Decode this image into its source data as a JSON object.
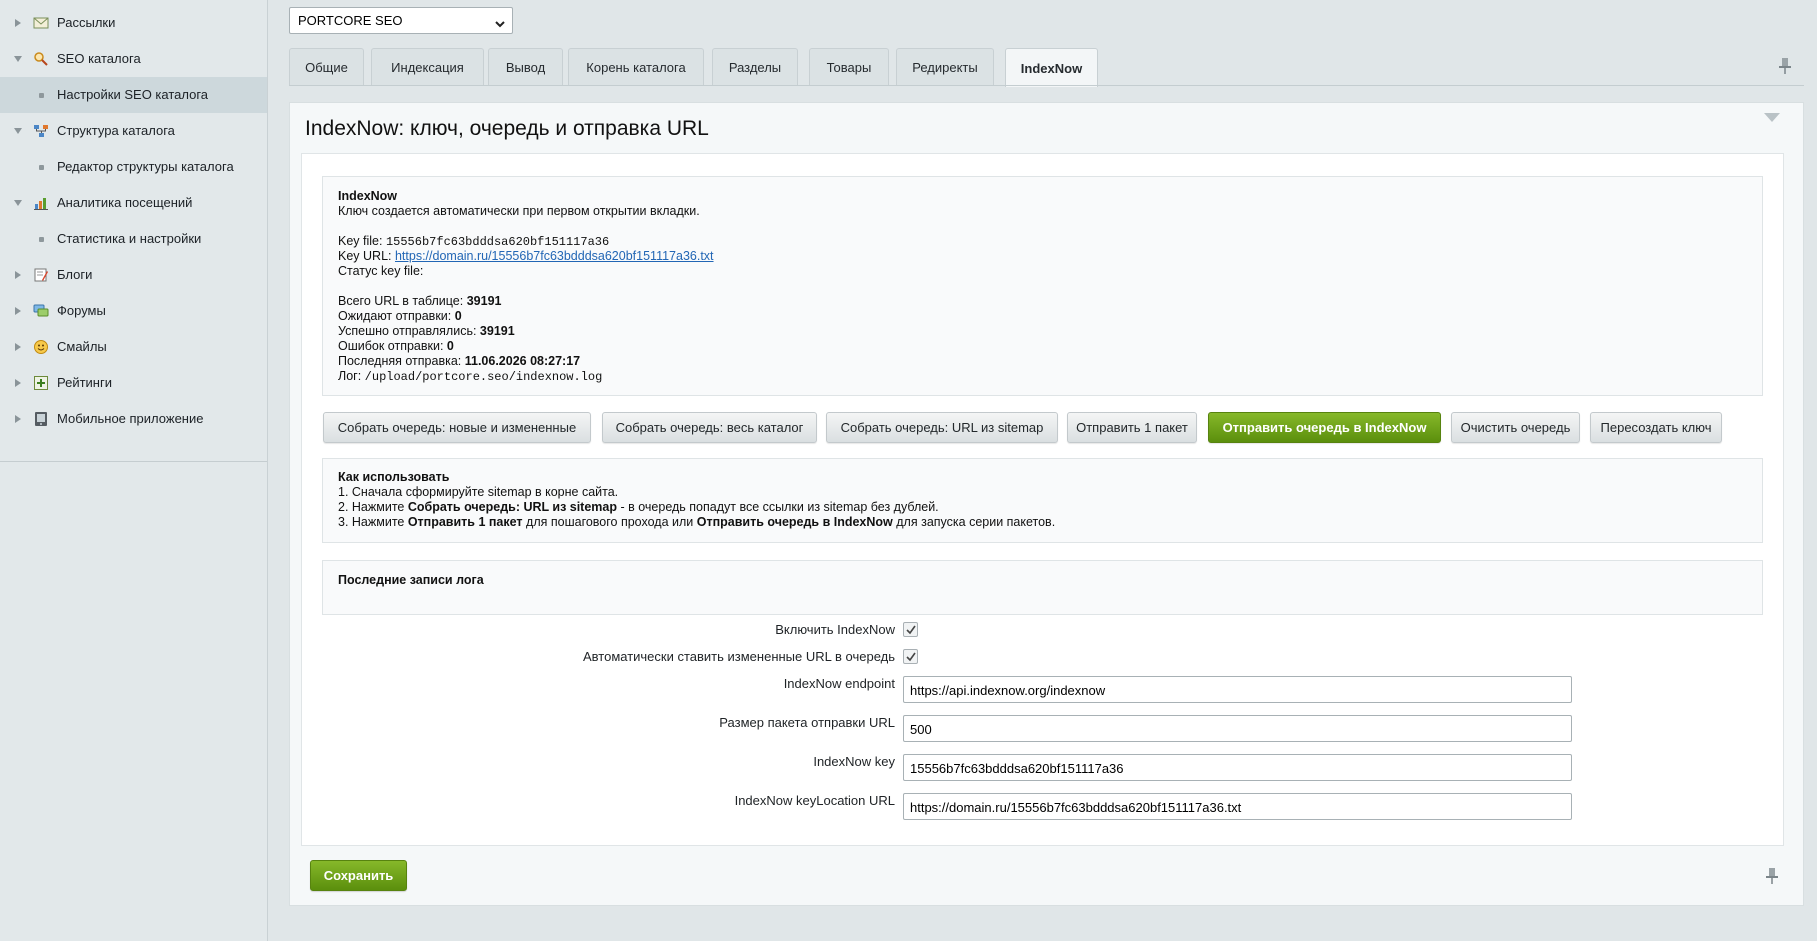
{
  "sidebar": {
    "items": [
      {
        "label": "Рассылки",
        "icon": "mail-icon"
      },
      {
        "label": "SEO каталога",
        "icon": "seo-search-icon"
      },
      {
        "label": "Настройки SEO каталога"
      },
      {
        "label": "Структура каталога",
        "icon": "structure-icon"
      },
      {
        "label": "Редактор структуры каталога"
      },
      {
        "label": "Аналитика посещений",
        "icon": "analytics-icon"
      },
      {
        "label": "Статистика и настройки"
      },
      {
        "label": "Блоги",
        "icon": "blog-icon"
      },
      {
        "label": "Форумы",
        "icon": "forum-icon"
      },
      {
        "label": "Смайлы",
        "icon": "smile-icon"
      },
      {
        "label": "Рейтинги",
        "icon": "rating-icon"
      },
      {
        "label": "Мобильное приложение",
        "icon": "mobile-icon"
      }
    ]
  },
  "site_select": {
    "value": "PORTCORE SEO"
  },
  "tabs": [
    {
      "label": "Общие"
    },
    {
      "label": "Индексация"
    },
    {
      "label": "Вывод"
    },
    {
      "label": "Корень каталога"
    },
    {
      "label": "Разделы"
    },
    {
      "label": "Товары"
    },
    {
      "label": "Редиректы"
    },
    {
      "label": "IndexNow"
    }
  ],
  "panel": {
    "title": "IndexNow: ключ, очередь и отправка URL"
  },
  "info": {
    "heading": "IndexNow",
    "subtitle": "Ключ создается автоматически при первом открытии вкладки.",
    "key_file_label": "Key file:",
    "key_file": "15556b7fc63bdddsa620bf151117a36",
    "key_url_label": "Key URL:",
    "key_url": "https://domain.ru/15556b7fc63bdddsa620bf151117a36.txt",
    "status_label": "Статус key file:",
    "total_label": "Всего URL в таблице:",
    "total": "39191",
    "pending_label": "Ожидают отправки:",
    "pending": "0",
    "success_label": "Успешно отправлялись:",
    "success": "39191",
    "errors_label": "Ошибок отправки:",
    "errors": "0",
    "last_label": "Последняя отправка:",
    "last": "11.06.2026 08:27:17",
    "log_label": "Лог:",
    "log": "/upload/portcore.seo/indexnow.log"
  },
  "buttons": {
    "collect_new": "Собрать очередь: новые и измененные",
    "collect_all": "Собрать очередь: весь каталог",
    "collect_sitemap": "Собрать очередь: URL из sitemap",
    "send_one": "Отправить 1 пакет",
    "send_queue": "Отправить очередь в IndexNow",
    "clear_queue": "Очистить очередь",
    "recreate_key": "Пересоздать ключ"
  },
  "howto": {
    "heading": "Как использовать",
    "step1": "1. Сначала сформируйте sitemap в корне сайта.",
    "step2_a": "2. Нажмите ",
    "step2_b": "Собрать очередь: URL из sitemap",
    "step2_c": " - в очередь попадут все ссылки из sitemap без дублей.",
    "step3_a": "3. Нажмите ",
    "step3_b": "Отправить 1 пакет",
    "step3_c": " для пошагового прохода или ",
    "step3_d": "Отправить очередь в IndexNow",
    "step3_e": " для запуска серии пакетов."
  },
  "log_box": {
    "heading": "Последние записи лога"
  },
  "form": {
    "enable_label": "Включить IndexNow",
    "enable_checked": true,
    "auto_label": "Автоматически ставить измененные URL в очередь",
    "auto_checked": true,
    "endpoint_label": "IndexNow endpoint",
    "endpoint_value": "https://api.indexnow.org/indexnow",
    "batch_label": "Размер пакета отправки URL",
    "batch_value": "500",
    "key_label": "IndexNow key",
    "key_value": "15556b7fc63bdddsa620bf151117a36",
    "key_location_label": "IndexNow keyLocation URL",
    "key_location_value": "https://domain.ru/15556b7fc63bdddsa620bf151117a36.txt"
  },
  "save": {
    "label": "Сохранить"
  },
  "colors": {
    "accent_green": "#6a9d17",
    "link": "#2266b5"
  }
}
